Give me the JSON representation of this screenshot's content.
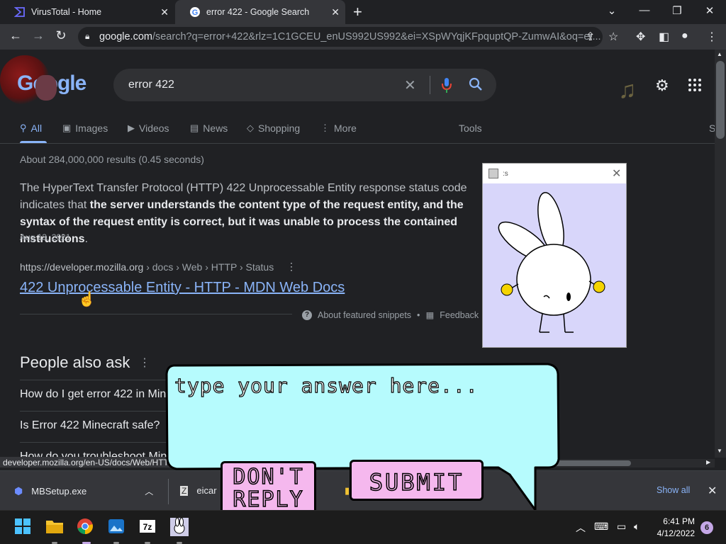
{
  "browser": {
    "tabs": [
      {
        "title": "VirusTotal - Home",
        "active": false
      },
      {
        "title": "error 422 - Google Search",
        "active": true
      }
    ],
    "address": {
      "host": "google.com",
      "path": "/search?q=error+422&rlz=1C1GCEU_enUS992US992&ei=XSpWYqjKFpquptQP-ZumwAI&oq=er..."
    },
    "status_url": "developer.mozilla.org/en-US/docs/Web/HTTP/Status/422"
  },
  "google": {
    "logo": "Google",
    "query": "error 422",
    "nav_tabs": [
      "All",
      "Images",
      "Videos",
      "News",
      "Shopping",
      "More"
    ],
    "tools": "Tools",
    "s_trunc": "S",
    "results_count": "About 284,000,000 results (0.45 seconds)",
    "snippet_lead": "The HyperText Transfer Protocol (HTTP) 422 Unprocessable Entity response status code indicates that ",
    "snippet_bold": "the server understands the content type of the request entity, and the syntax of the request entity is correct, but it was unable to process the contained instructions",
    "snippet_end": ".",
    "snippet_date": "Aug 13, 2021",
    "result_url": "https://developer.mozilla.org",
    "result_crumbs": " › docs › Web › HTTP › Status",
    "result_title": "422 Unprocessable Entity - HTTP - MDN Web Docs",
    "about_snippets": "About featured snippets",
    "feedback": "Feedback",
    "paa_title": "People also ask",
    "paa_questions": [
      "How do I get error 422 in Min",
      "Is Error 422 Minecraft safe?",
      "How do you troubleshoot Min"
    ]
  },
  "popup": {
    "title": ":s"
  },
  "bubble": {
    "prompt": "type your answer here...",
    "dont_reply_line1": "DON'T",
    "dont_reply_line2": "REPLY",
    "submit": "SUBMIT"
  },
  "downloads": {
    "items": [
      "MBSetup.exe",
      "eicar"
    ],
    "show_all": "Show all"
  },
  "taskbar": {
    "time": "6:41 PM",
    "date": "4/12/2022",
    "notifications": "6"
  },
  "colors": {
    "link": "#8ab4f8",
    "bubble": "#b6fbfd",
    "button": "#f5b8ee",
    "popup_bg": "#d8d6fa"
  }
}
